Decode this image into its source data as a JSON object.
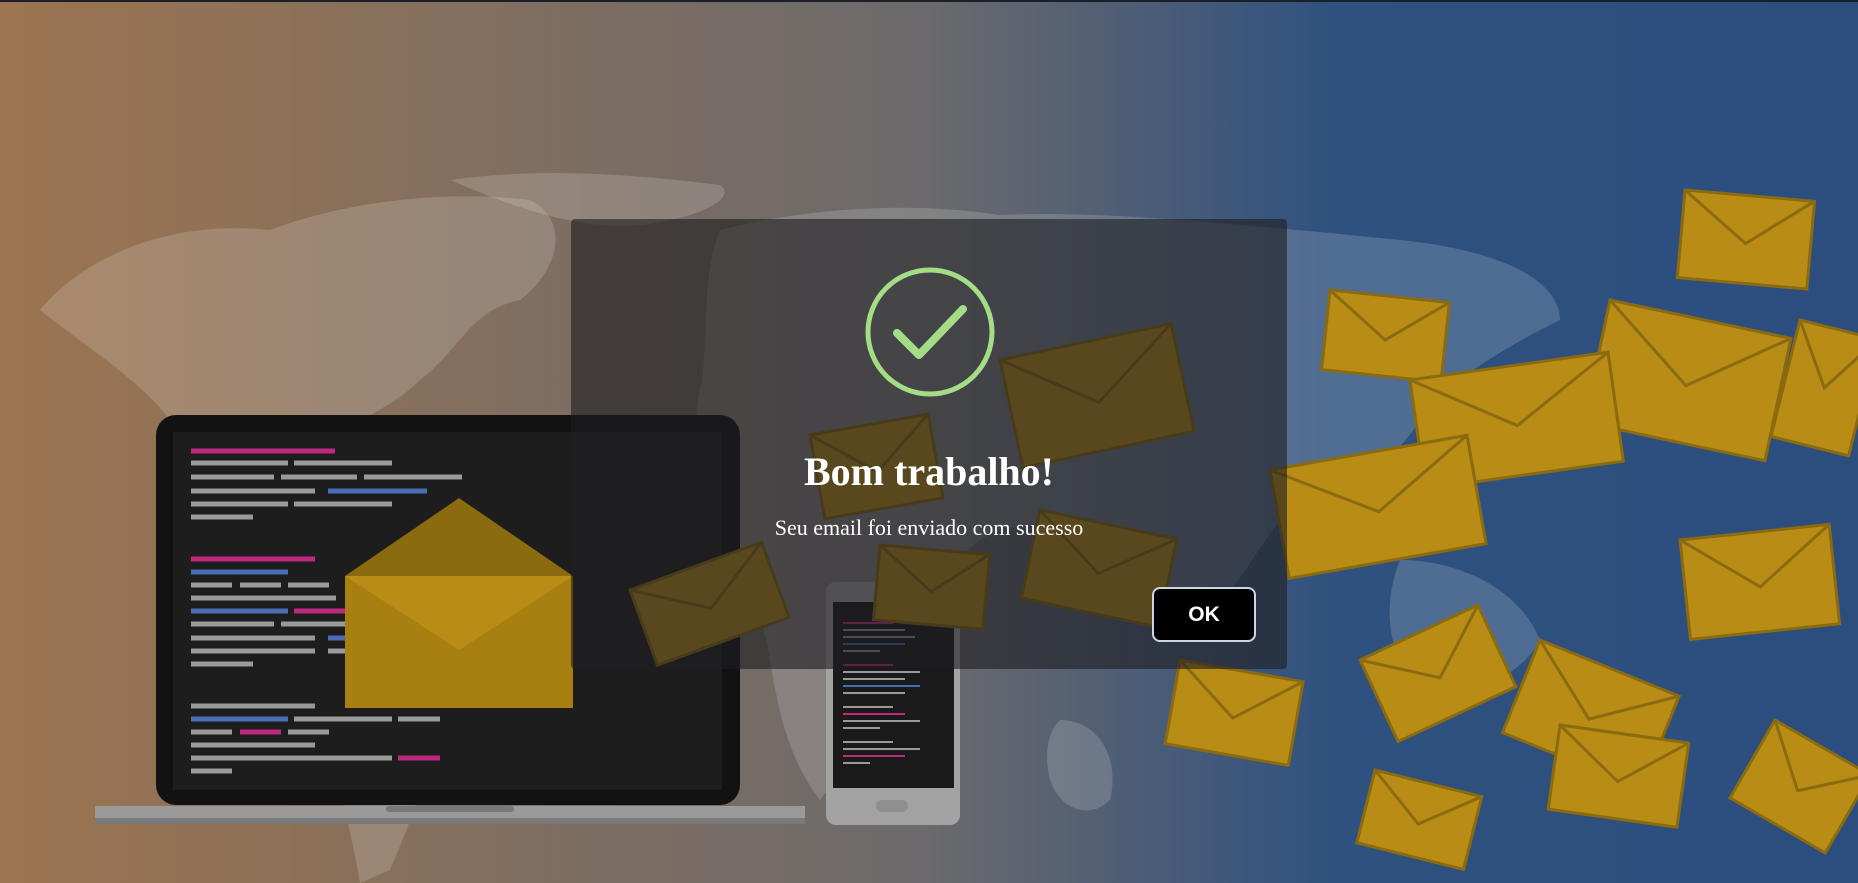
{
  "background": {
    "gradient_left": "#9c7450",
    "gradient_mid": "#6b6a6c",
    "gradient_right": "#2d5080",
    "envelope_color": "#b88c15"
  },
  "dialog": {
    "icon": "success-check-icon",
    "icon_color": "#a5dc86",
    "title": "Bom trabalho!",
    "message": "Seu email foi enviado com sucesso",
    "ok_label": "OK"
  }
}
